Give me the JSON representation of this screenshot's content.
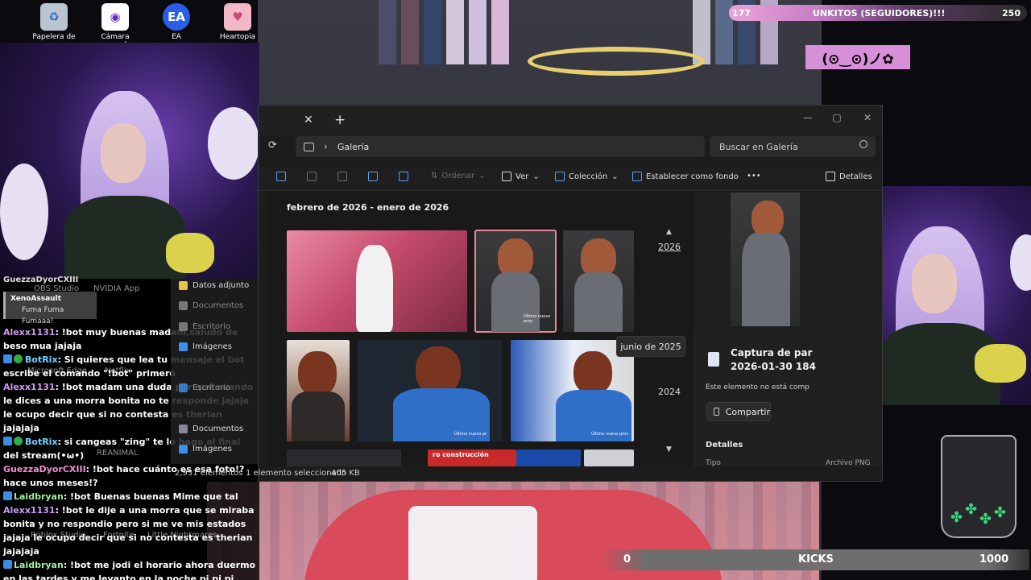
{
  "desktop": {
    "icons": [
      {
        "label": "Papelera de",
        "icon": "recycle-bin-icon"
      },
      {
        "label": "Cámara apagada",
        "icon": "camera-app-icon"
      },
      {
        "label": "EA",
        "icon": "ea-app-icon"
      },
      {
        "label": "Heartopia",
        "icon": "heartopia-app-icon"
      }
    ],
    "ghost_labels": [
      "OBS Studio",
      "NVIDIA App",
      "Microsoft Edge",
      "Netflix",
      "REANIMAL",
      "Roblox Studio",
      "Fortnite",
      "Little Nightmares"
    ]
  },
  "side_nav": {
    "items": [
      {
        "label": "Datos adjunto",
        "icon": "folder-icon"
      },
      {
        "label": "Documentos",
        "icon": "documents-icon"
      },
      {
        "label": "Escritorio",
        "icon": "desktop-icon"
      },
      {
        "label": "Imágenes",
        "icon": "images-icon"
      },
      {
        "label": "Escritorio",
        "icon": "desktop-icon"
      },
      {
        "label": "Documentos",
        "icon": "documents-icon"
      },
      {
        "label": "Imágenes",
        "icon": "images-icon"
      }
    ]
  },
  "chat": {
    "reply": {
      "user": "XenoAssault",
      "text": "Fuma Fuma Fumaaa!"
    },
    "partial_user": "GuezzaDyorCXIII",
    "messages": [
      {
        "user": "Alexx1131",
        "color": "#c99bf0",
        "text": ": !bot muy buenas madam,saludo de beso mua jajaja"
      },
      {
        "user": "BotRix",
        "color": "#6fd3ff",
        "text": ": Si quieres que lea tu mensaje el bot escribe el comando \"!bot\" primero"
      },
      {
        "user": "Alexx1131",
        "color": "#c99bf0",
        "text": ": !bot madam una duda por qué cuando le dices a una morra bonita no te responde jajaja le ocupo decir que si no contesta es therian jajajaja"
      },
      {
        "user": "BotRix",
        "color": "#6fd3ff",
        "text": ": si cangeas \"zing\" te lo hago al final del stream(•ω•)"
      },
      {
        "user": "GuezzaDyorCXIII",
        "color": "#f08fd0",
        "text": ": !bot hace cuánto es esa foto!? hace unos meses!?"
      },
      {
        "user": "Laidbryan",
        "color": "#9df09d",
        "text": ": !bot Buenas buenas Mime que tal"
      },
      {
        "user": "Alexx1131",
        "color": "#c99bf0",
        "text": ": !bot le dije a una morra que se miraba bonita y no respondio pero si me ve mis estados jajaja le ocupo decir que si no contesta es therian jajajaja"
      },
      {
        "user": "Laidbryan",
        "color": "#9df09d",
        "text": ": !bot me jodi el horario ahora duermo en las tardes y me levanto en la noche pi pi pi"
      }
    ]
  },
  "gallery": {
    "tab_close": "✕",
    "tab_new": "+",
    "window_controls": [
      "—",
      "▢",
      "✕"
    ],
    "breadcrumb": "Galería",
    "search_placeholder": "Buscar en Galería",
    "toolbar": {
      "sort": "Ordenar",
      "view": "Ver",
      "collection": "Colección",
      "set_background": "Establecer como fondo",
      "more": "•••",
      "details": "Detalles"
    },
    "date_range": "febrero de 2026 - enero de 2026",
    "timeline": {
      "year_top": "2026",
      "tooltip": "junio de 2025",
      "year_mid": "2024"
    },
    "details": {
      "file_title_1": "Captura de par",
      "file_title_2": "2026-01-30 184",
      "not_on_device": "Este elemento no está comp",
      "share": "Compartir",
      "section": "Detalles",
      "type_label": "Tipo",
      "type_value": "Archivo PNG"
    },
    "thumb_caption": "Último nuevo proy",
    "thumb_caption2": "Último nuevo pr",
    "thumb_caption3": "Último nuevo prov",
    "construction_text": "ro construcción",
    "status": {
      "count": "2,931 elementos",
      "selected": "1 elemento seleccionado",
      "size": "405 KB"
    }
  },
  "overlays": {
    "followers": {
      "current": "177",
      "label": "UNKITOS (SEGUIDORES)!!!",
      "goal": "250"
    },
    "kaomoji": "(⊙‿⊙)ノ✿",
    "kicks": {
      "current": "0",
      "label": "KICKS",
      "goal": "1000"
    }
  },
  "colors": {
    "accent_pink": "#e38b9a",
    "follow_bar": "#c77cc7",
    "window_bg": "#1c1c1c"
  }
}
